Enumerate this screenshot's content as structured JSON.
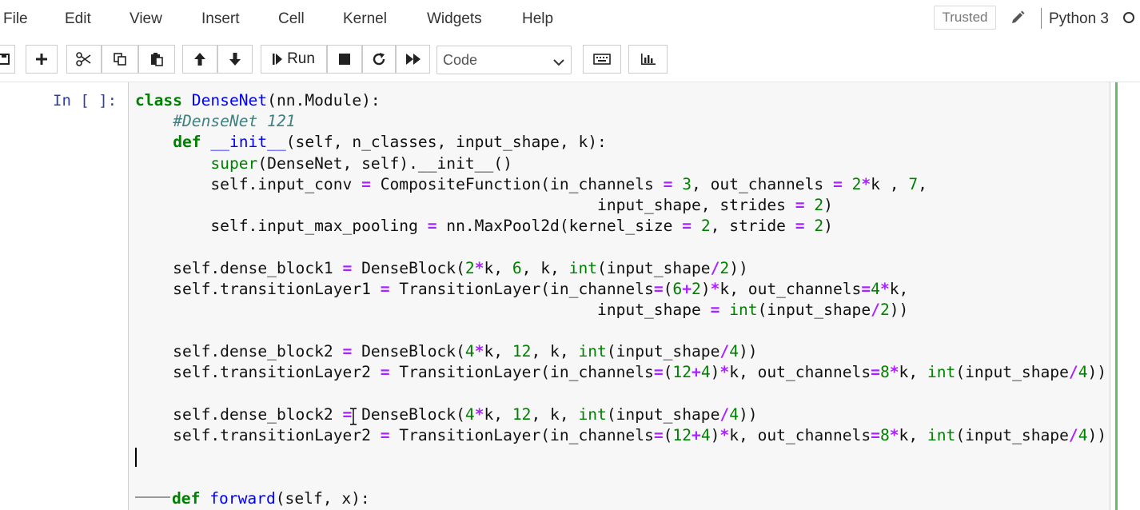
{
  "menu": {
    "items": [
      "File",
      "Edit",
      "View",
      "Insert",
      "Cell",
      "Kernel",
      "Widgets",
      "Help"
    ],
    "trusted_label": "Trusted",
    "kernel_name": "Python 3"
  },
  "toolbar": {
    "run_label": "Run",
    "cell_type": "Code",
    "icons": [
      "save-icon",
      "add-cell-icon",
      "cut-icon",
      "copy-icon",
      "paste-icon",
      "move-up-icon",
      "move-down-icon",
      "run-icon",
      "stop-icon",
      "restart-icon",
      "fast-forward-icon",
      "keyboard-icon",
      "chart-icon"
    ]
  },
  "cell": {
    "prompt": "In [ ]:",
    "lines": [
      [
        {
          "t": "kw",
          "v": "class"
        },
        {
          "t": "",
          "v": " "
        },
        {
          "t": "cls",
          "v": "DenseNet"
        },
        {
          "t": "",
          "v": "(nn.Module):"
        }
      ],
      [
        {
          "t": "",
          "v": "    "
        },
        {
          "t": "cm",
          "v": "#DenseNet 121"
        }
      ],
      [
        {
          "t": "",
          "v": "    "
        },
        {
          "t": "kw",
          "v": "def"
        },
        {
          "t": "",
          "v": " "
        },
        {
          "t": "dunder",
          "v": "__init__"
        },
        {
          "t": "",
          "v": "(self, n_classes, input_shape, k):"
        }
      ],
      [
        {
          "t": "",
          "v": "        "
        },
        {
          "t": "nb",
          "v": "super"
        },
        {
          "t": "",
          "v": "(DenseNet, self).__init__()"
        }
      ],
      [
        {
          "t": "",
          "v": "        self.input_conv "
        },
        {
          "t": "op",
          "v": "="
        },
        {
          "t": "",
          "v": " CompositeFunction(in_channels "
        },
        {
          "t": "op",
          "v": "="
        },
        {
          "t": "",
          "v": " "
        },
        {
          "t": "num",
          "v": "3"
        },
        {
          "t": "",
          "v": ", out_channels "
        },
        {
          "t": "op",
          "v": "="
        },
        {
          "t": "",
          "v": " "
        },
        {
          "t": "num",
          "v": "2"
        },
        {
          "t": "op",
          "v": "*"
        },
        {
          "t": "",
          "v": "k , "
        },
        {
          "t": "num",
          "v": "7"
        },
        {
          "t": "",
          "v": ","
        }
      ],
      [
        {
          "t": "",
          "v": "                                                 input_shape, strides "
        },
        {
          "t": "op",
          "v": "="
        },
        {
          "t": "",
          "v": " "
        },
        {
          "t": "num",
          "v": "2"
        },
        {
          "t": "",
          "v": ")"
        }
      ],
      [
        {
          "t": "",
          "v": "        self.input_max_pooling "
        },
        {
          "t": "op",
          "v": "="
        },
        {
          "t": "",
          "v": " nn.MaxPool2d(kernel_size "
        },
        {
          "t": "op",
          "v": "="
        },
        {
          "t": "",
          "v": " "
        },
        {
          "t": "num",
          "v": "2"
        },
        {
          "t": "",
          "v": ", stride "
        },
        {
          "t": "op",
          "v": "="
        },
        {
          "t": "",
          "v": " "
        },
        {
          "t": "num",
          "v": "2"
        },
        {
          "t": "",
          "v": ")"
        }
      ],
      [],
      [
        {
          "t": "",
          "v": "    self.dense_block1 "
        },
        {
          "t": "op",
          "v": "="
        },
        {
          "t": "",
          "v": " DenseBlock("
        },
        {
          "t": "num",
          "v": "2"
        },
        {
          "t": "op",
          "v": "*"
        },
        {
          "t": "",
          "v": "k, "
        },
        {
          "t": "num",
          "v": "6"
        },
        {
          "t": "",
          "v": ", k, "
        },
        {
          "t": "nb",
          "v": "int"
        },
        {
          "t": "",
          "v": "(input_shape"
        },
        {
          "t": "op",
          "v": "/"
        },
        {
          "t": "num",
          "v": "2"
        },
        {
          "t": "",
          "v": "))"
        }
      ],
      [
        {
          "t": "",
          "v": "    self.transitionLayer1 "
        },
        {
          "t": "op",
          "v": "="
        },
        {
          "t": "",
          "v": " TransitionLayer(in_channels"
        },
        {
          "t": "op",
          "v": "="
        },
        {
          "t": "",
          "v": "("
        },
        {
          "t": "num",
          "v": "6"
        },
        {
          "t": "op",
          "v": "+"
        },
        {
          "t": "num",
          "v": "2"
        },
        {
          "t": "",
          "v": ")"
        },
        {
          "t": "op",
          "v": "*"
        },
        {
          "t": "",
          "v": "k, out_channels"
        },
        {
          "t": "op",
          "v": "="
        },
        {
          "t": "num",
          "v": "4"
        },
        {
          "t": "op",
          "v": "*"
        },
        {
          "t": "",
          "v": "k,"
        }
      ],
      [
        {
          "t": "",
          "v": "                                                 input_shape "
        },
        {
          "t": "op",
          "v": "="
        },
        {
          "t": "",
          "v": " "
        },
        {
          "t": "nb",
          "v": "int"
        },
        {
          "t": "",
          "v": "(input_shape"
        },
        {
          "t": "op",
          "v": "/"
        },
        {
          "t": "num",
          "v": "2"
        },
        {
          "t": "",
          "v": "))"
        }
      ],
      [],
      [
        {
          "t": "",
          "v": "    self.dense_block2 "
        },
        {
          "t": "op",
          "v": "="
        },
        {
          "t": "",
          "v": " DenseBlock("
        },
        {
          "t": "num",
          "v": "4"
        },
        {
          "t": "op",
          "v": "*"
        },
        {
          "t": "",
          "v": "k, "
        },
        {
          "t": "num",
          "v": "12"
        },
        {
          "t": "",
          "v": ", k, "
        },
        {
          "t": "nb",
          "v": "int"
        },
        {
          "t": "",
          "v": "(input_shape"
        },
        {
          "t": "op",
          "v": "/"
        },
        {
          "t": "num",
          "v": "4"
        },
        {
          "t": "",
          "v": "))"
        }
      ],
      [
        {
          "t": "",
          "v": "    self.transitionLayer2 "
        },
        {
          "t": "op",
          "v": "="
        },
        {
          "t": "",
          "v": " TransitionLayer(in_channels"
        },
        {
          "t": "op",
          "v": "="
        },
        {
          "t": "",
          "v": "("
        },
        {
          "t": "num",
          "v": "12"
        },
        {
          "t": "op",
          "v": "+"
        },
        {
          "t": "num",
          "v": "4"
        },
        {
          "t": "",
          "v": ")"
        },
        {
          "t": "op",
          "v": "*"
        },
        {
          "t": "",
          "v": "k, out_channels"
        },
        {
          "t": "op",
          "v": "="
        },
        {
          "t": "num",
          "v": "8"
        },
        {
          "t": "op",
          "v": "*"
        },
        {
          "t": "",
          "v": "k, "
        },
        {
          "t": "nb",
          "v": "int"
        },
        {
          "t": "",
          "v": "(input_shape"
        },
        {
          "t": "op",
          "v": "/"
        },
        {
          "t": "num",
          "v": "4"
        },
        {
          "t": "",
          "v": "))"
        }
      ],
      [],
      [
        {
          "t": "",
          "v": "    self.dense_block2 "
        },
        {
          "t": "op",
          "v": "="
        },
        {
          "t": "",
          "v": " DenseBlock("
        },
        {
          "t": "num",
          "v": "4"
        },
        {
          "t": "op",
          "v": "*"
        },
        {
          "t": "",
          "v": "k, "
        },
        {
          "t": "num",
          "v": "12"
        },
        {
          "t": "",
          "v": ", k, "
        },
        {
          "t": "nb",
          "v": "int"
        },
        {
          "t": "",
          "v": "(input_shape"
        },
        {
          "t": "op",
          "v": "/"
        },
        {
          "t": "num",
          "v": "4"
        },
        {
          "t": "",
          "v": "))"
        }
      ],
      [
        {
          "t": "",
          "v": "    self.transitionLayer2 "
        },
        {
          "t": "op",
          "v": "="
        },
        {
          "t": "",
          "v": " TransitionLayer(in_channels"
        },
        {
          "t": "op",
          "v": "="
        },
        {
          "t": "",
          "v": "("
        },
        {
          "t": "num",
          "v": "12"
        },
        {
          "t": "op",
          "v": "+"
        },
        {
          "t": "num",
          "v": "4"
        },
        {
          "t": "",
          "v": ")"
        },
        {
          "t": "op",
          "v": "*"
        },
        {
          "t": "",
          "v": "k, out_channels"
        },
        {
          "t": "op",
          "v": "="
        },
        {
          "t": "num",
          "v": "8"
        },
        {
          "t": "op",
          "v": "*"
        },
        {
          "t": "",
          "v": "k, "
        },
        {
          "t": "nb",
          "v": "int"
        },
        {
          "t": "",
          "v": "(input_shape"
        },
        {
          "t": "op",
          "v": "/"
        },
        {
          "t": "num",
          "v": "4"
        },
        {
          "t": "",
          "v": "))"
        }
      ],
      [],
      [],
      [
        {
          "t": "tab",
          "v": ""
        },
        {
          "t": "kw",
          "v": "def"
        },
        {
          "t": "",
          "v": " "
        },
        {
          "t": "cls",
          "v": "forward"
        },
        {
          "t": "",
          "v": "(self, x):"
        }
      ]
    ]
  },
  "colors": {
    "keyword": "#008000",
    "class_name": "#0000ff",
    "comment": "#408080",
    "operator": "#aa22ff",
    "prompt": "#303f9f",
    "cell_edge": "#66bb6a"
  }
}
